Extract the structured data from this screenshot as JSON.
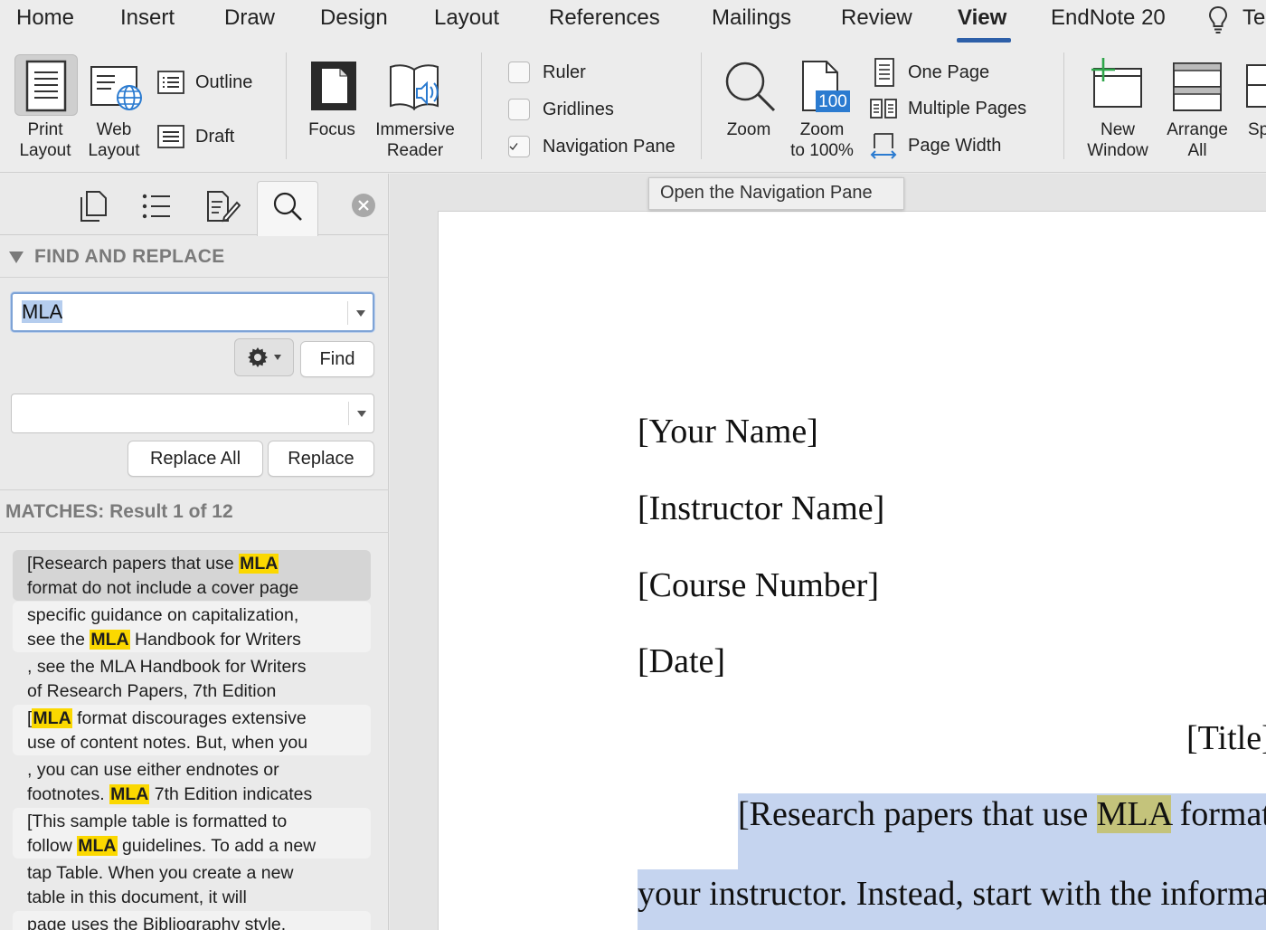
{
  "menu_tabs": [
    {
      "label": "Home"
    },
    {
      "label": "Insert"
    },
    {
      "label": "Draw"
    },
    {
      "label": "Design"
    },
    {
      "label": "Layout"
    },
    {
      "label": "References"
    },
    {
      "label": "Mailings"
    },
    {
      "label": "Review"
    },
    {
      "label": "View",
      "active": true
    },
    {
      "label": "EndNote 20"
    },
    {
      "label": "Te"
    }
  ],
  "ribbon": {
    "views": {
      "print_layout": [
        "Print",
        "Layout"
      ],
      "web_layout": [
        "Web",
        "Layout"
      ],
      "outline": "Outline",
      "draft": "Draft"
    },
    "immersive": {
      "focus": "Focus",
      "immersive_reader": [
        "Immersive",
        "Reader"
      ]
    },
    "show": {
      "ruler": {
        "label": "Ruler",
        "checked": false
      },
      "gridlines": {
        "label": "Gridlines",
        "checked": false
      },
      "navigation_pane": {
        "label": "Navigation Pane",
        "checked": true
      }
    },
    "zoom": {
      "zoom": "Zoom",
      "zoom_100": [
        "Zoom",
        "to 100%"
      ],
      "zoom_100_badge": "100",
      "one_page": "One Page",
      "multiple_pages": "Multiple Pages",
      "page_width": "Page Width"
    },
    "window": {
      "new_window": [
        "New",
        "Window"
      ],
      "arrange_all": [
        "Arrange",
        "All"
      ],
      "split": "Sp"
    }
  },
  "tooltip": "Open the Navigation Pane",
  "nav_pane": {
    "section_title": "FIND AND REPLACE",
    "search_value": "MLA",
    "find_label": "Find",
    "replace_value": "",
    "replace_all_label": "Replace All",
    "replace_label": "Replace",
    "matches_label": "MATCHES: Result 1 of 12",
    "results": [
      {
        "before": "[Research papers that use ",
        "match": "MLA",
        "after": "\nformat do not include a cover page",
        "state": "selected"
      },
      {
        "before": "specific guidance on capitalization,\nsee the ",
        "match": "MLA",
        "after": " Handbook for Writers",
        "state": "alt"
      },
      {
        "before": ", see the MLA Handbook for Writers\nof Research Papers, 7th Edition",
        "match": "",
        "after": "",
        "state": "plain"
      },
      {
        "before": "[",
        "match": "MLA",
        "after": " format discourages extensive\nuse of content notes. But, when you",
        "state": "alt"
      },
      {
        "before": ", you can use either endnotes or\nfootnotes. ",
        "match": "MLA",
        "after": " 7th Edition indicates",
        "state": "plain"
      },
      {
        "before": "[This sample table is formatted to\nfollow ",
        "match": "MLA",
        "after": " guidelines. To add a new",
        "state": "alt"
      },
      {
        "before": "tap Table. When you create a new\ntable in this document, it will",
        "match": "",
        "after": "",
        "state": "plain"
      },
      {
        "before": "page uses the Bibliography style.",
        "match": "",
        "after": "",
        "state": "alt"
      }
    ]
  },
  "document": {
    "your_name": "[Your Name]",
    "instructor_name": "[Instructor Name]",
    "course_number": "[Course Number]",
    "date": "[Date]",
    "title": "[Title]:",
    "para1_before": "[Research papers that use ",
    "para1_match": "MLA",
    "para1_after": " format ",
    "para2": "your instructor. Instead, start with the informati"
  },
  "colors": {
    "accent": "#2d5fa8",
    "match_highlight": "#fbd800",
    "doc_selection": "#c5d4ef"
  }
}
